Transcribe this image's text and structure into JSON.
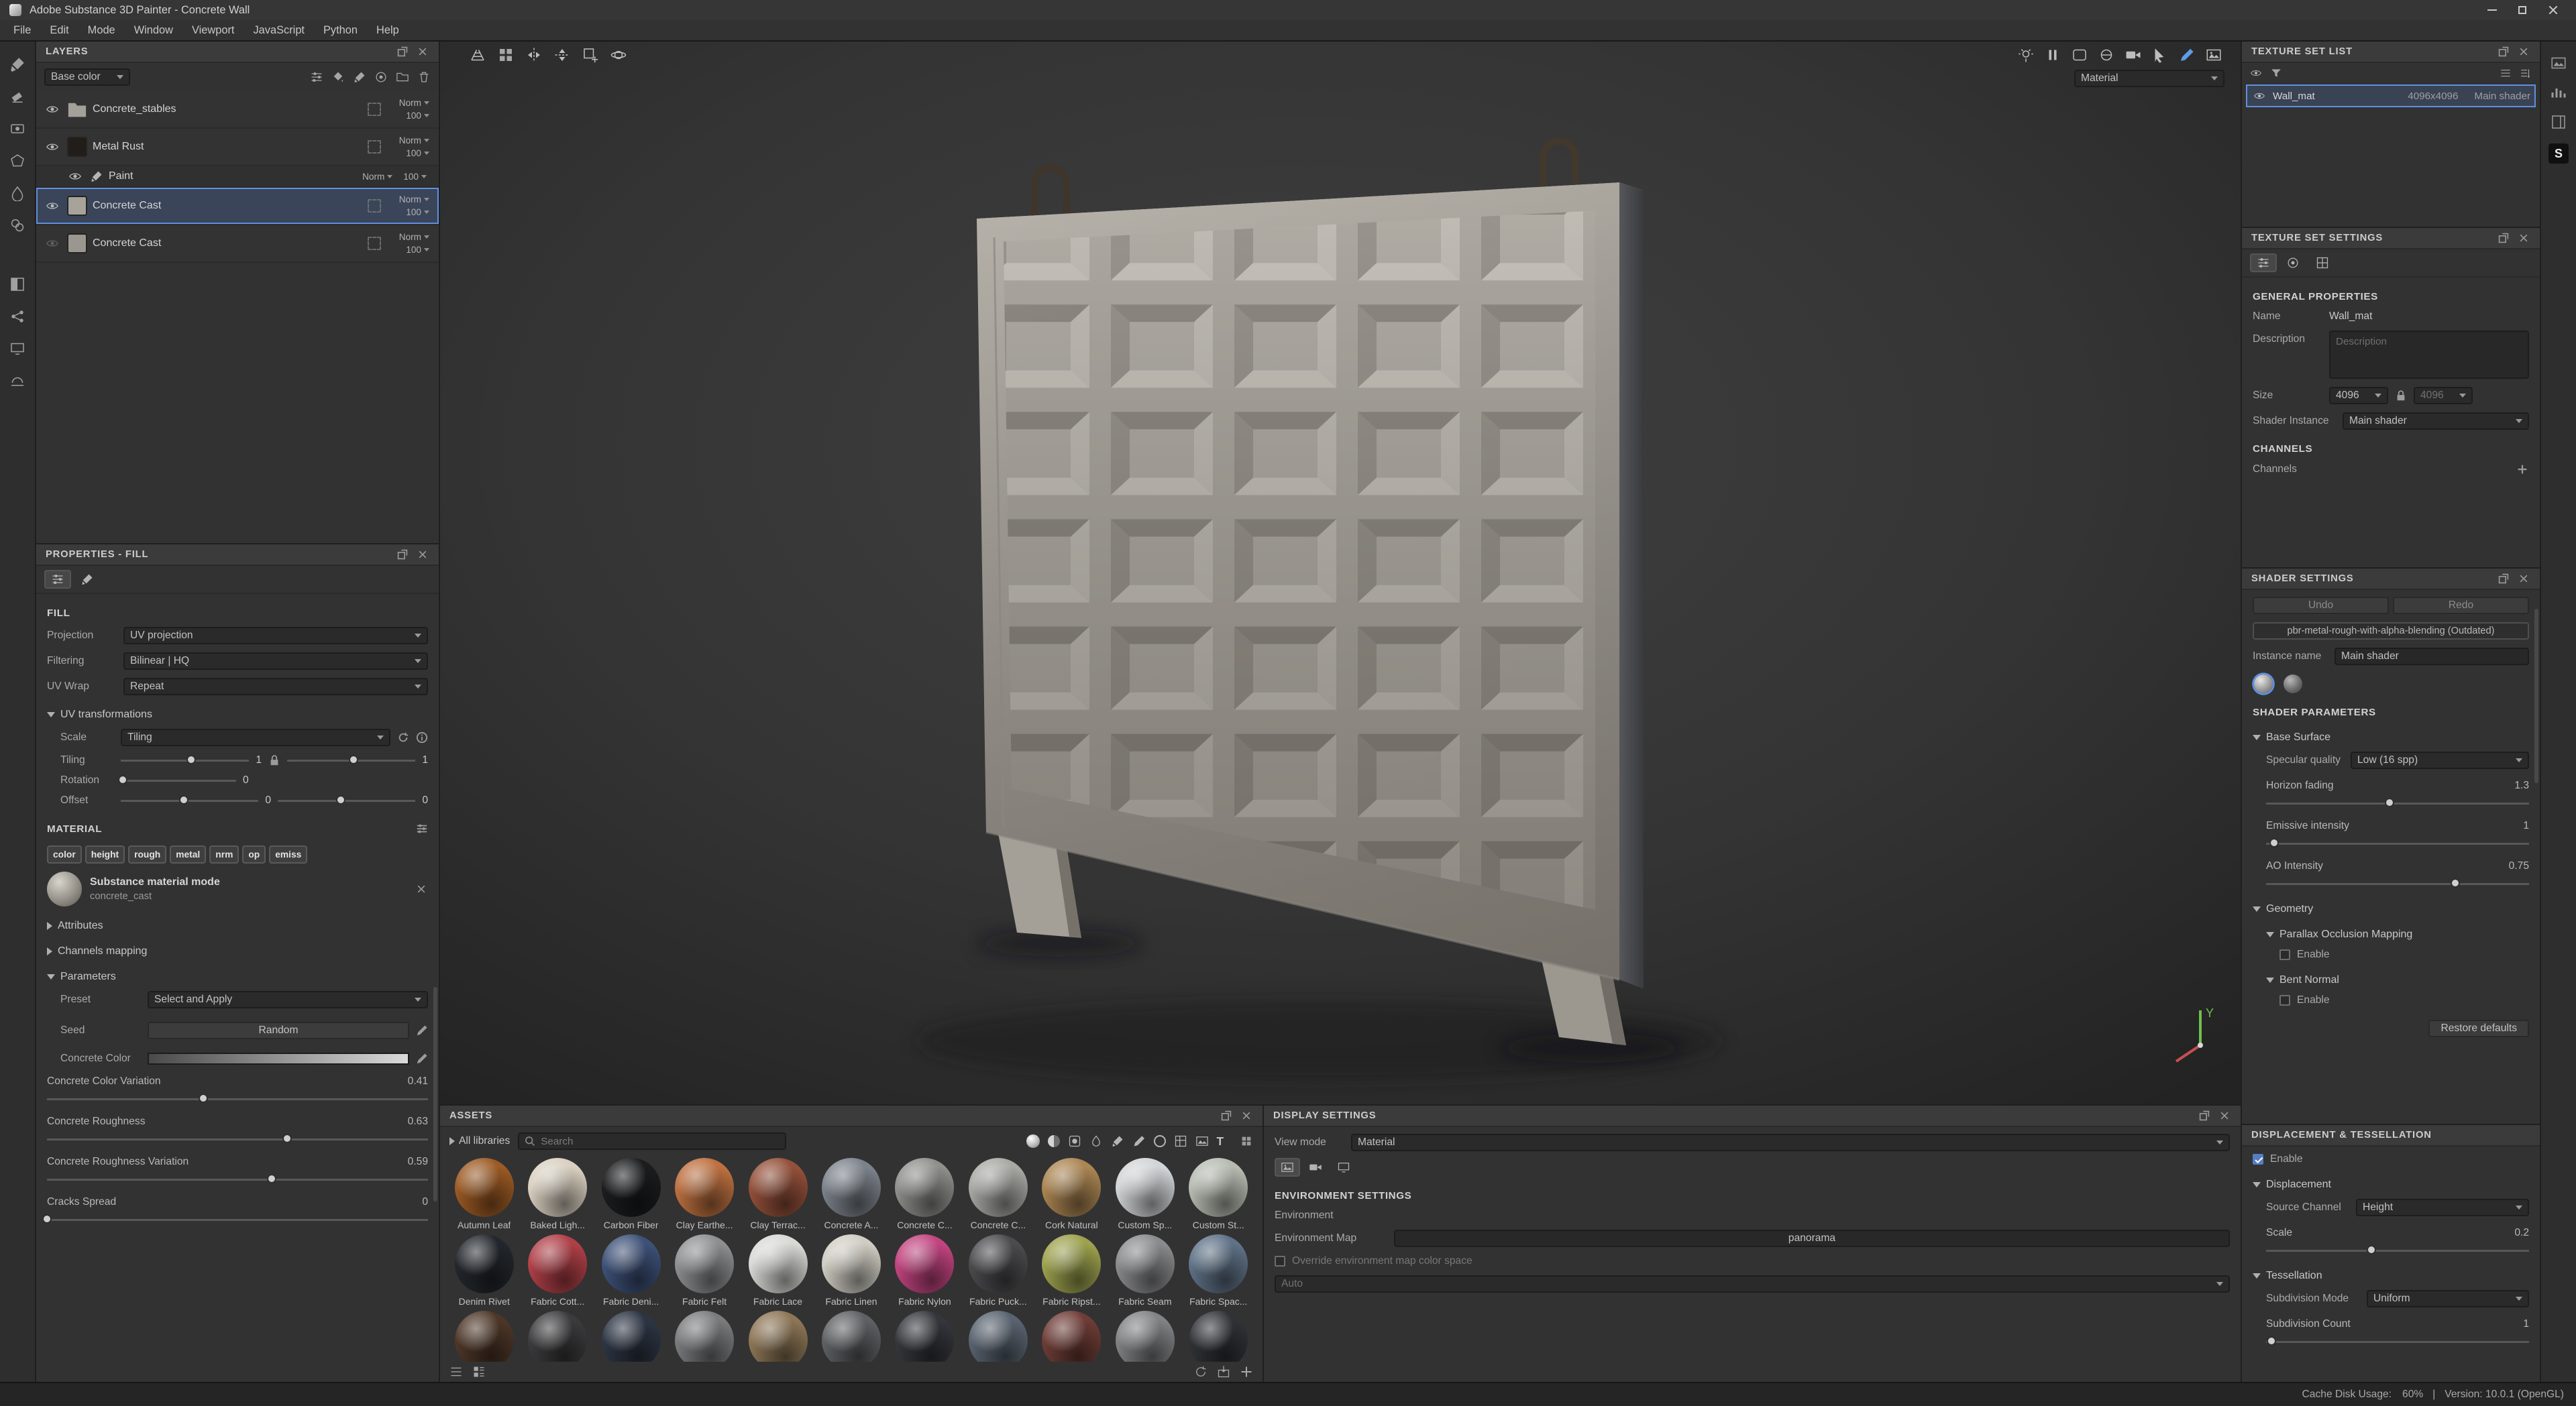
{
  "title_bar": {
    "title": "Adobe Substance 3D Painter - Concrete Wall"
  },
  "menu_bar": {
    "items": [
      "File",
      "Edit",
      "Mode",
      "Window",
      "Viewport",
      "JavaScript",
      "Python",
      "Help"
    ]
  },
  "right_strip": {
    "logo": "S"
  },
  "layers_panel": {
    "title": "LAYERS",
    "channel_selector": "Base color",
    "layers": [
      {
        "name": "Concrete_stables",
        "blend": "Norm",
        "opacity": "100",
        "thumb": "#8d8a83"
      },
      {
        "name": "Metal Rust",
        "blend": "Norm",
        "opacity": "100",
        "thumb": "#221d19"
      },
      {
        "name": "Paint",
        "blend": "Norm",
        "opacity": "100"
      },
      {
        "name": "Concrete Cast",
        "blend": "Norm",
        "opacity": "100",
        "thumb": "#a7a39b"
      },
      {
        "name": "Concrete Cast",
        "blend": "Norm",
        "opacity": "100",
        "thumb": "#9b9790"
      }
    ]
  },
  "properties_panel": {
    "title": "PROPERTIES - FILL",
    "fill": {
      "section": "FILL",
      "projection_label": "Projection",
      "projection_value": "UV projection",
      "filtering_label": "Filtering",
      "filtering_value": "Bilinear | HQ",
      "uv_wrap_label": "UV Wrap",
      "uv_wrap_value": "Repeat",
      "uv_transformations": "UV transformations",
      "scale_label": "Scale",
      "scale_value": "Tiling",
      "tiling_label": "Tiling",
      "tiling_x": "1",
      "tiling_y": "1",
      "rotation_label": "Rotation",
      "rotation_value": "0",
      "offset_label": "Offset",
      "offset_x": "0",
      "offset_y": "0"
    },
    "material": {
      "section": "MATERIAL",
      "channels": [
        "color",
        "height",
        "rough",
        "metal",
        "nrm",
        "op",
        "emiss"
      ],
      "mode_title": "Substance material mode",
      "mode_subtitle": "concrete_cast"
    },
    "groups": {
      "attributes": "Attributes",
      "channels_mapping": "Channels mapping",
      "parameters": "Parameters"
    },
    "parameters": {
      "preset_label": "Preset",
      "preset_value": "Select and Apply",
      "seed_label": "Seed",
      "seed_value": "Random",
      "color_label": "Concrete Color",
      "sliders": [
        {
          "label": "Concrete Color Variation",
          "value": "0.41"
        },
        {
          "label": "Concrete Roughness",
          "value": "0.63"
        },
        {
          "label": "Concrete Roughness Variation",
          "value": "0.59"
        },
        {
          "label": "Cracks Spread",
          "value": "0"
        }
      ]
    }
  },
  "viewport": {
    "shading_mode": "Material",
    "gizmo_y": "Y"
  },
  "assets_panel": {
    "title": "ASSETS",
    "library_selector": "All libraries",
    "search_placeholder": "Search",
    "assets": [
      {
        "name": "Autumn Leaf",
        "color": "#9c5a24"
      },
      {
        "name": "Baked Ligh...",
        "color": "#d9d0c1"
      },
      {
        "name": "Carbon Fiber",
        "color": "#1b1c1e"
      },
      {
        "name": "Clay Earthe...",
        "color": "#bd7040"
      },
      {
        "name": "Clay Terrac...",
        "color": "#94503a"
      },
      {
        "name": "Concrete A...",
        "color": "#7c828b"
      },
      {
        "name": "Concrete C...",
        "color": "#8f8f8c"
      },
      {
        "name": "Concrete C...",
        "color": "#a8a8a4"
      },
      {
        "name": "Cork Natural",
        "color": "#ab8552"
      },
      {
        "name": "Custom Sp...",
        "color": "#d2d5d7"
      },
      {
        "name": "Custom St...",
        "color": "#b7bbb1"
      },
      {
        "name": "Denim Rivet",
        "color": "#23272d"
      },
      {
        "name": "Fabric Cott...",
        "color": "#b04048"
      },
      {
        "name": "Fabric Deni...",
        "color": "#3d5178"
      },
      {
        "name": "Fabric Felt",
        "color": "#8d8f91"
      },
      {
        "name": "Fabric Lace",
        "color": "#d9d9d6"
      },
      {
        "name": "Fabric Linen",
        "color": "#d0cdc3"
      },
      {
        "name": "Fabric Nylon",
        "color": "#c24480"
      },
      {
        "name": "Fabric Puck...",
        "color": "#4b4b4e"
      },
      {
        "name": "Fabric Ripst...",
        "color": "#9da24e"
      },
      {
        "name": "Fabric Seam",
        "color": "#8a8b8d"
      },
      {
        "name": "Fabric Spac...",
        "color": "#5f7287"
      }
    ],
    "partial_row": [
      "#4d3628",
      "#3b3b3d",
      "#2d3544",
      "#7a7b7d",
      "#8d7656",
      "#5e6063",
      "#35363c",
      "#59636f",
      "#6e3c36",
      "#808284",
      "#303236"
    ]
  },
  "display_settings": {
    "title": "DISPLAY SETTINGS",
    "view_mode_label": "View mode",
    "view_mode_value": "Material",
    "environment_section": "ENVIRONMENT SETTINGS",
    "environment_label": "Environment",
    "environment_map_label": "Environment Map",
    "environment_map_value": "panorama",
    "override_label": "Override environment map color space",
    "color_space_value": "Auto"
  },
  "texture_set_list": {
    "title": "TEXTURE SET LIST",
    "set": {
      "name": "Wall_mat",
      "resolution": "4096x4096",
      "shader": "Main shader"
    }
  },
  "texture_set_settings": {
    "title": "TEXTURE SET SETTINGS",
    "general_section": "GENERAL PROPERTIES",
    "name_label": "Name",
    "name_value": "Wall_mat",
    "description_label": "Description",
    "description_placeholder": "Description",
    "size_label": "Size",
    "size_width": "4096",
    "size_height": "4096",
    "shader_instance_label": "Shader Instance",
    "shader_instance_value": "Main shader",
    "channels_section": "CHANNELS",
    "channels_label": "Channels"
  },
  "shader_settings": {
    "title": "SHADER SETTINGS",
    "undo_label": "Undo",
    "redo_label": "Redo",
    "shader_name": "pbr-metal-rough-with-alpha-blending (Outdated)",
    "instance_name_label": "Instance name",
    "instance_name_value": "Main shader",
    "parameters_section": "SHADER PARAMETERS",
    "base_surface_group": "Base Surface",
    "specular_label": "Specular quality",
    "specular_value": "Low (16 spp)",
    "sliders": [
      {
        "label": "Horizon fading",
        "value": "1.3"
      },
      {
        "label": "Emissive intensity",
        "value": "1"
      },
      {
        "label": "AO Intensity",
        "value": "0.75"
      }
    ],
    "geometry_group": "Geometry",
    "pom_group": "Parallax Occlusion Mapping",
    "pom_enable_label": "Enable",
    "bent_group": "Bent Normal",
    "bent_enable_label": "Enable",
    "restore_label": "Restore defaults"
  },
  "displacement_panel": {
    "title": "DISPLACEMENT & TESSELLATION",
    "enable_label": "Enable",
    "displacement_group": "Displacement",
    "source_channel_label": "Source Channel",
    "source_channel_value": "Height",
    "scale_label": "Scale",
    "scale_value": "0.2",
    "tessellation_group": "Tessellation",
    "subdivision_mode_label": "Subdivision Mode",
    "subdivision_mode_value": "Uniform",
    "subdivision_count_label": "Subdivision Count",
    "subdivision_count_value": "1"
  },
  "status_bar": {
    "cache_label": "Cache Disk Usage:",
    "cache_value": "60%",
    "separator": "|",
    "version": "Version: 10.0.1 (OpenGL)"
  }
}
